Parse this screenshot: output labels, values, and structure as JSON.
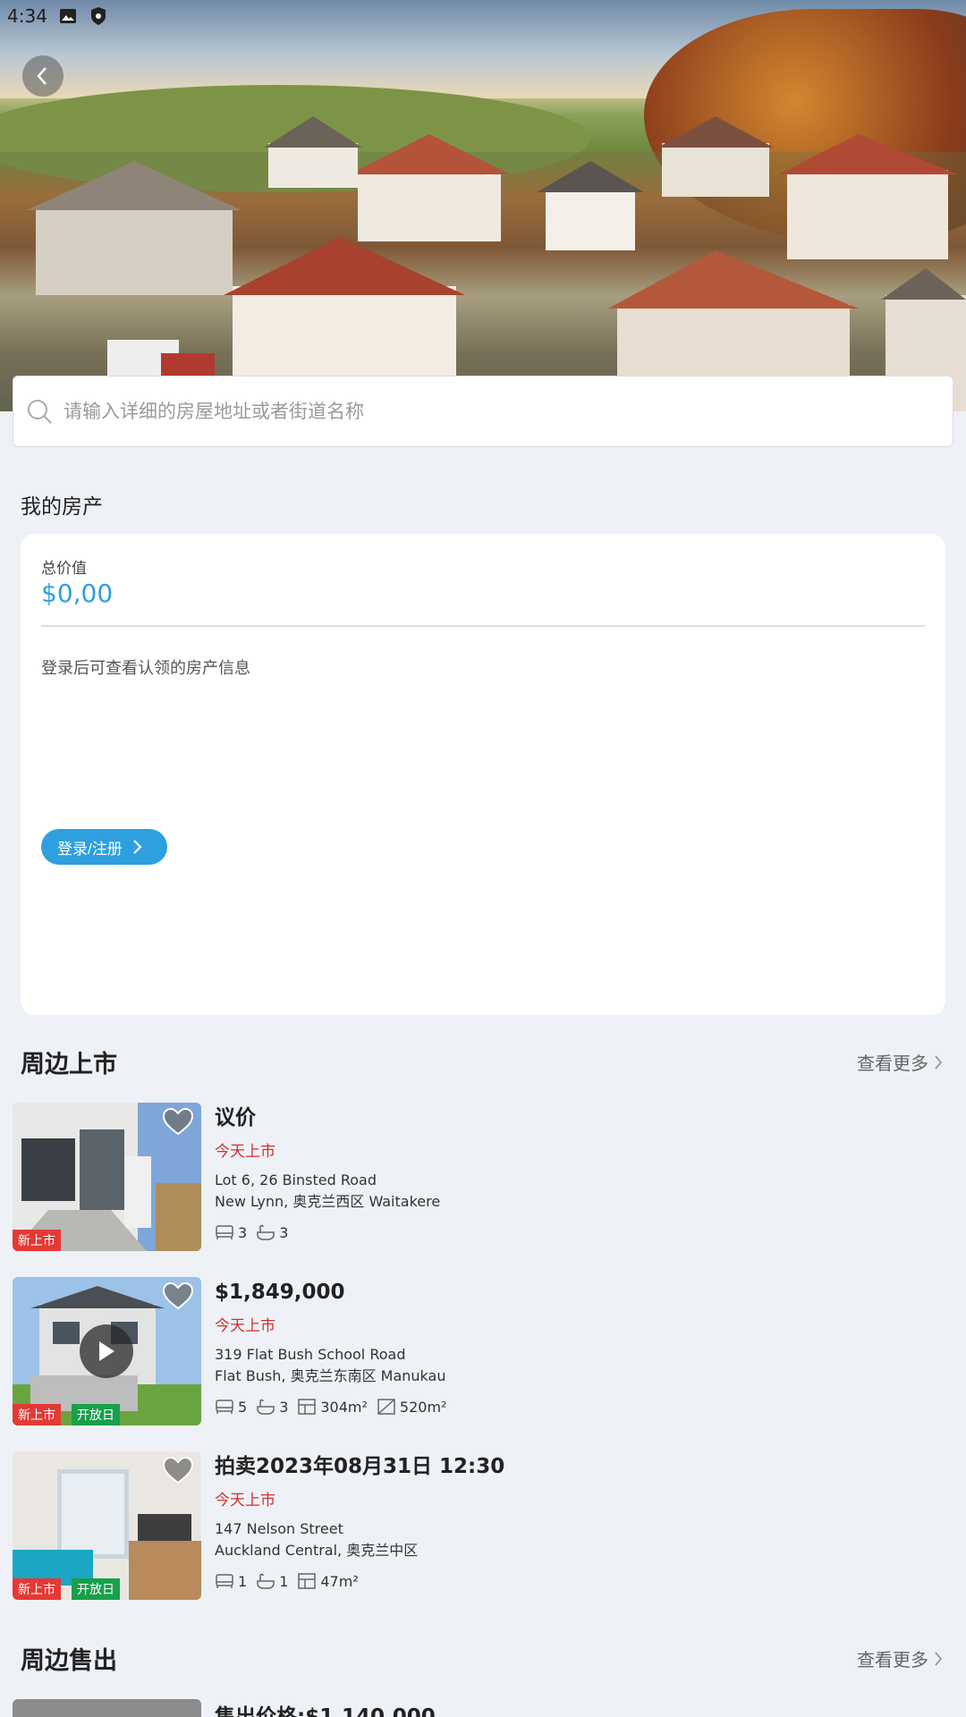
{
  "status_bar": {
    "time": "4:34"
  },
  "search": {
    "placeholder": "请输入详细的房屋地址或者街道名称"
  },
  "my_property": {
    "title": "我的房产",
    "total_label": "总价值",
    "total_value": "$0,00",
    "message": "登录后可查看认领的房产信息",
    "login_button": "登录/注册"
  },
  "nearby_listings": {
    "title": "周边上市",
    "more_label": "查看更多",
    "items": [
      {
        "price": "议价",
        "listed": "今天上市",
        "address_line1": "Lot 6, 26 Binsted Road",
        "address_line2": "New Lynn, 奥克兰西区 Waitakere",
        "bedrooms": "3",
        "bathrooms": "3",
        "tags": [
          "新上市"
        ]
      },
      {
        "price": "$1,849,000",
        "listed": "今天上市",
        "address_line1": "319 Flat Bush School Road",
        "address_line2": "Flat Bush, 奥克兰东南区 Manukau",
        "bedrooms": "5",
        "bathrooms": "3",
        "floor_area": "304m²",
        "land_area": "520m²",
        "tags": [
          "新上市",
          "开放日"
        ]
      },
      {
        "price": "拍卖2023年08月31日 12:30",
        "listed": "今天上市",
        "address_line1": "147 Nelson Street",
        "address_line2": "Auckland Central, 奥克兰中区",
        "bedrooms": "1",
        "bathrooms": "1",
        "floor_area": "47m²",
        "tags": [
          "新上市",
          "开放日"
        ]
      }
    ]
  },
  "nearby_sold": {
    "title": "周边售出",
    "more_label": "查看更多",
    "first_price": "售出价格:$1,140,000"
  },
  "colors": {
    "accent": "#2ea0e0",
    "new_tag": "#e53935",
    "open_tag": "#18a04a",
    "listed_red": "#d32f2f"
  }
}
